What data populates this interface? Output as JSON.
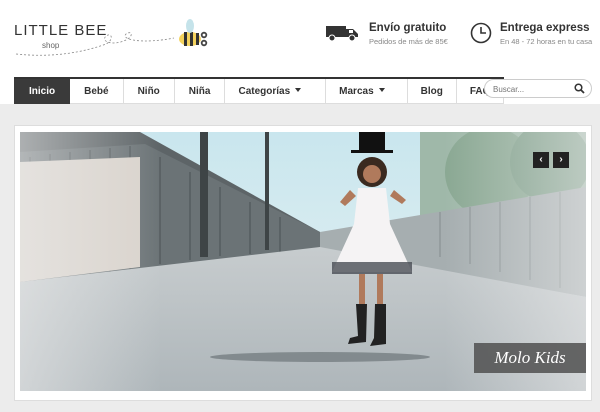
{
  "logo": {
    "title": "LITTLE BEE",
    "subtitle": "shop"
  },
  "features": [
    {
      "title": "Envío gratuito",
      "subtitle": "Pedidos de más de 85€",
      "icon": "truck-icon"
    },
    {
      "title": "Entrega express",
      "subtitle": "En 48 - 72 horas en tu casa",
      "icon": "clock-icon"
    }
  ],
  "nav": {
    "items": [
      {
        "label": "Inicio",
        "active": true
      },
      {
        "label": "Bebé"
      },
      {
        "label": "Niño"
      },
      {
        "label": "Niña"
      },
      {
        "label": "Categorías",
        "dropdown": true
      },
      {
        "label": "Marcas",
        "dropdown": true
      },
      {
        "label": "Blog"
      },
      {
        "label": "FAQ"
      }
    ]
  },
  "search": {
    "placeholder": "Buscar..."
  },
  "slider": {
    "caption": "Molo Kids",
    "prev_label": "‹",
    "next_label": "›"
  },
  "colors": {
    "nav_active": "#3a3a3a",
    "caption_bg": "#505050"
  }
}
